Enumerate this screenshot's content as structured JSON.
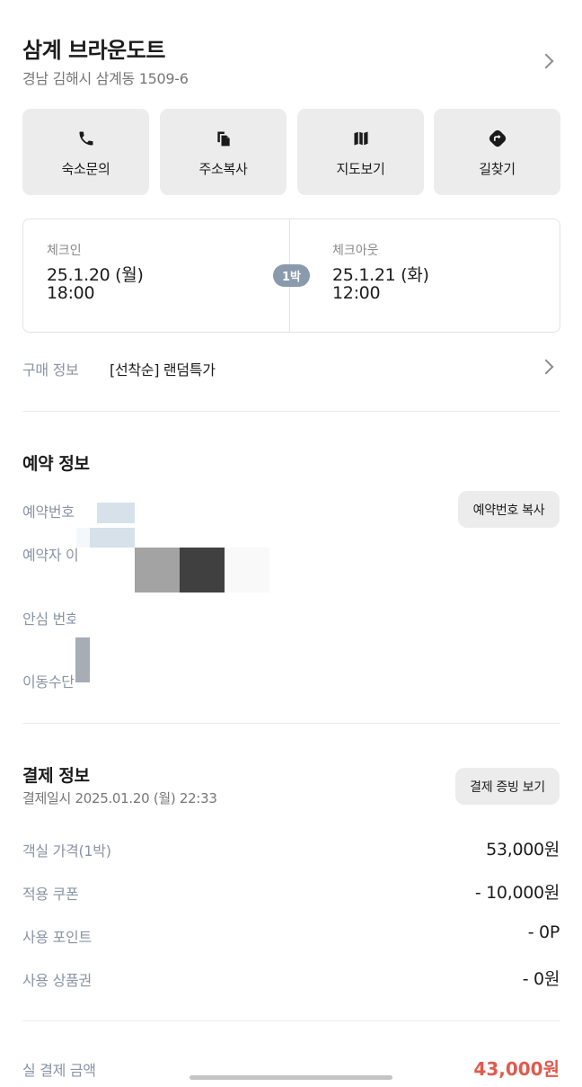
{
  "header": {
    "hotel_name": "삼계 브라운도트",
    "address": "경남 김해시 삼계동 1509-6"
  },
  "actions": [
    {
      "label": "숙소문의",
      "icon": "phone-icon"
    },
    {
      "label": "주소복사",
      "icon": "copy-icon"
    },
    {
      "label": "지도보기",
      "icon": "map-icon"
    },
    {
      "label": "길찾기",
      "icon": "directions-icon"
    }
  ],
  "stay": {
    "checkin_label": "체크인",
    "checkin_date": "25.1.20 (월)",
    "checkin_time": "18:00",
    "nights": "1박",
    "checkout_label": "체크아웃",
    "checkout_date": "25.1.21 (화)",
    "checkout_time": "12:00"
  },
  "purchase": {
    "label": "구매 정보",
    "value": "[선착순] 랜덤특가"
  },
  "reservation": {
    "title": "예약 정보",
    "number_label": "예약번호",
    "copy_button": "예약번호 복사",
    "booker_label": "예약자 이",
    "safe_number_label": "안심 번호",
    "transport_label": "이동수단"
  },
  "payment": {
    "title": "결제 정보",
    "datetime": "결제일시 2025.01.20 (월) 22:33",
    "receipt_button": "결제 증빙 보기",
    "rows": [
      {
        "label": "객실 가격(1박)",
        "value": "53,000원"
      },
      {
        "label": "적용 쿠폰",
        "value": "- 10,000원"
      },
      {
        "label": "사용 포인트",
        "value": "- 0P"
      },
      {
        "label": "사용 상품권",
        "value": "- 0원"
      }
    ],
    "total_label": "실 결제 금액",
    "total_value": "43,000원"
  },
  "colors": {
    "accent_red": "#e05a4e",
    "nights_badge": "#8a9aad",
    "button_bg": "#ececec"
  }
}
